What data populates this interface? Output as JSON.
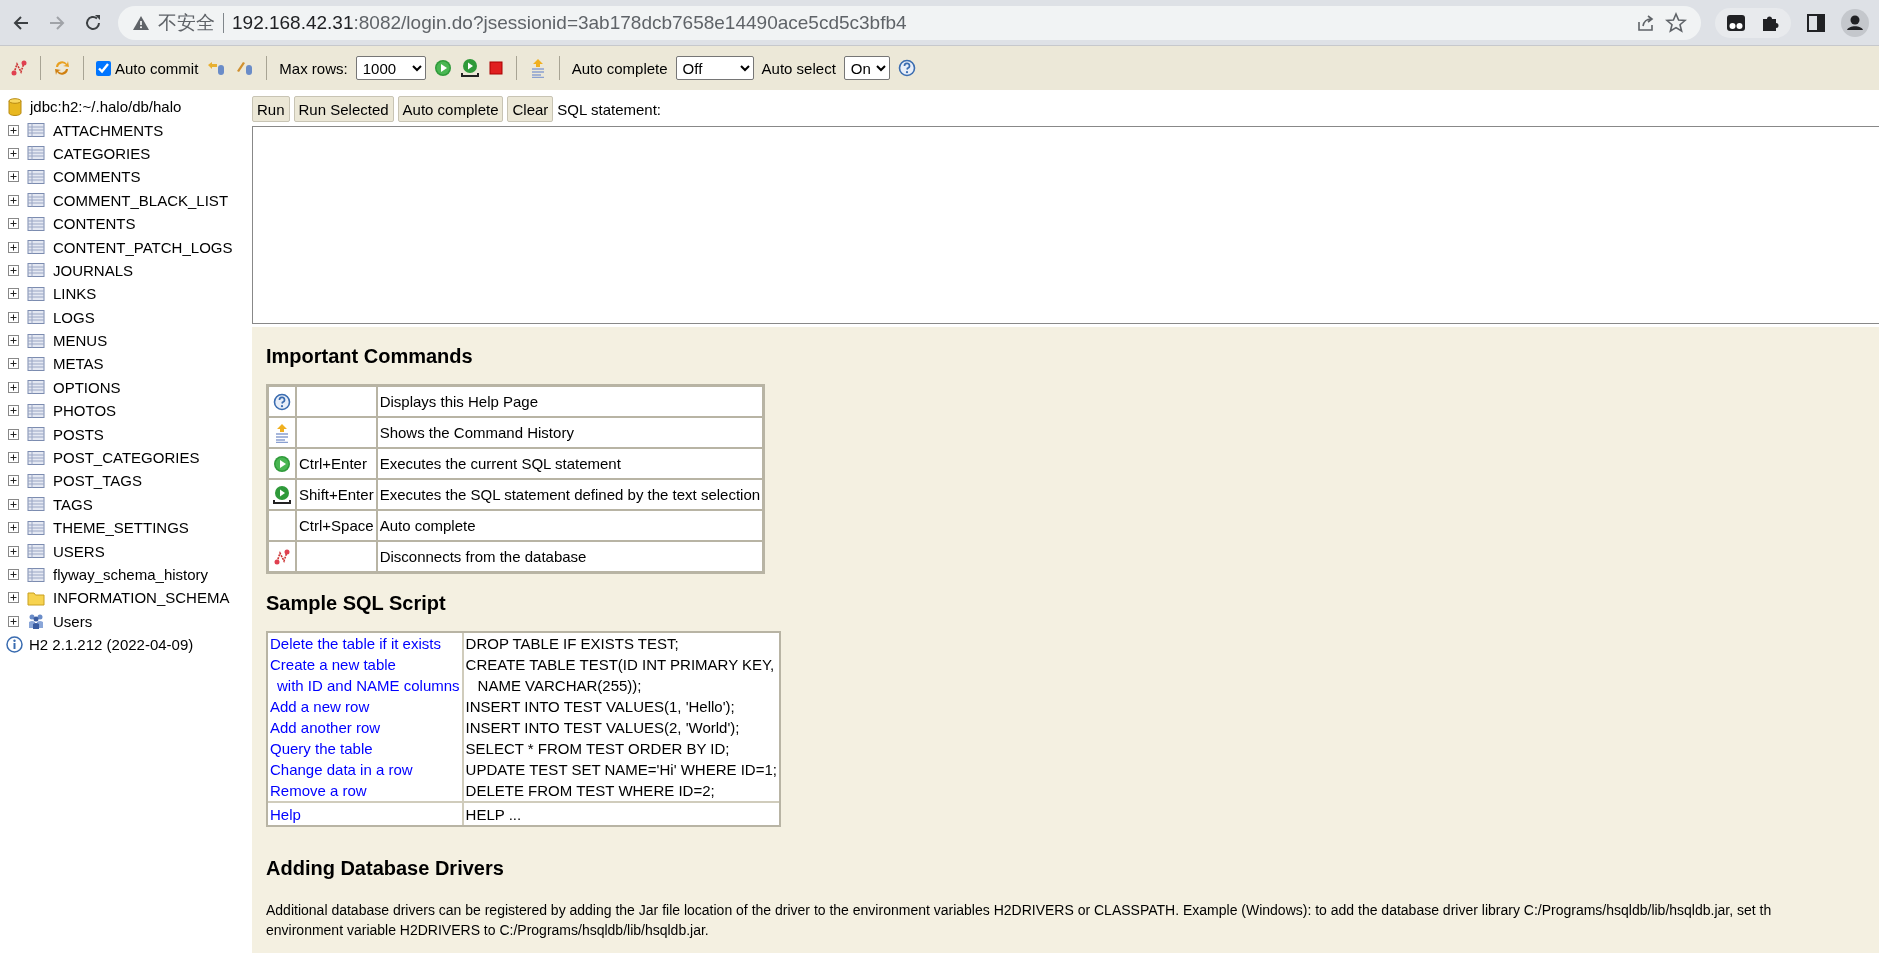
{
  "browser": {
    "security_label": "不安全",
    "url_host": "192.168.42.31",
    "url_rest": ":8082/login.do?jsessionid=3ab178dcb7658e14490ace5cd5c3bfb4"
  },
  "toolbar": {
    "auto_commit": {
      "label": "Auto commit",
      "checked": true
    },
    "max_rows": {
      "label": "Max rows:",
      "value": "1000"
    },
    "auto_complete": {
      "label": "Auto complete",
      "value": "Off"
    },
    "auto_select": {
      "label": "Auto select",
      "value": "On"
    }
  },
  "tree": {
    "connection": "jdbc:h2:~/.halo/db/halo",
    "items": [
      {
        "label": "ATTACHMENTS",
        "kind": "table",
        "expanded": false
      },
      {
        "label": "CATEGORIES",
        "kind": "table",
        "expanded": false
      },
      {
        "label": "COMMENTS",
        "kind": "table",
        "expanded": false
      },
      {
        "label": "COMMENT_BLACK_LIST",
        "kind": "table",
        "expanded": false
      },
      {
        "label": "CONTENTS",
        "kind": "table",
        "expanded": false
      },
      {
        "label": "CONTENT_PATCH_LOGS",
        "kind": "table",
        "expanded": false
      },
      {
        "label": "JOURNALS",
        "kind": "table",
        "expanded": false
      },
      {
        "label": "LINKS",
        "kind": "table",
        "expanded": false
      },
      {
        "label": "LOGS",
        "kind": "table",
        "expanded": false
      },
      {
        "label": "MENUS",
        "kind": "table",
        "expanded": false
      },
      {
        "label": "METAS",
        "kind": "table",
        "expanded": false
      },
      {
        "label": "OPTIONS",
        "kind": "table",
        "expanded": false
      },
      {
        "label": "PHOTOS",
        "kind": "table",
        "expanded": false
      },
      {
        "label": "POSTS",
        "kind": "table",
        "expanded": false
      },
      {
        "label": "POST_CATEGORIES",
        "kind": "table",
        "expanded": false
      },
      {
        "label": "POST_TAGS",
        "kind": "table",
        "expanded": false
      },
      {
        "label": "TAGS",
        "kind": "table",
        "expanded": false
      },
      {
        "label": "THEME_SETTINGS",
        "kind": "table",
        "expanded": false
      },
      {
        "label": "USERS",
        "kind": "table",
        "expanded": false
      },
      {
        "label": "flyway_schema_history",
        "kind": "table",
        "expanded": false
      },
      {
        "label": "INFORMATION_SCHEMA",
        "kind": "folder",
        "expanded": false
      },
      {
        "label": "Users",
        "kind": "users",
        "expanded": false
      }
    ],
    "version": "H2 2.1.212 (2022-04-09)"
  },
  "query": {
    "buttons": [
      "Run",
      "Run Selected",
      "Auto complete",
      "Clear"
    ],
    "label": "SQL statement:"
  },
  "help": {
    "commands_title": "Important Commands",
    "commands": [
      {
        "kind": "help",
        "text": "Displays this Help Page"
      },
      {
        "kind": "history",
        "text": "Shows the Command History"
      },
      {
        "kind": "run",
        "shortcut": "Ctrl+Enter",
        "text": "Executes the current SQL statement"
      },
      {
        "kind": "run_selected",
        "shortcut": "Shift+Enter",
        "text": "Executes the SQL statement defined by the text selection"
      },
      {
        "kind": "none",
        "shortcut": "Ctrl+Space",
        "text": "Auto complete"
      },
      {
        "kind": "disconnect",
        "text": "Disconnects from the database"
      }
    ],
    "sample_title": "Sample SQL Script",
    "samples": [
      {
        "label": "Delete the table if it exists",
        "sql": "DROP TABLE IF EXISTS TEST;",
        "continued": false
      },
      {
        "label": "Create a new table",
        "sql": "CREATE TABLE TEST(ID INT PRIMARY KEY,",
        "continued": false
      },
      {
        "label": "with ID and NAME columns",
        "sql": "NAME VARCHAR(255));",
        "continued": true
      },
      {
        "label": "Add a new row",
        "sql": "INSERT INTO TEST VALUES(1, 'Hello');",
        "continued": false
      },
      {
        "label": "Add another row",
        "sql": "INSERT INTO TEST VALUES(2, 'World');",
        "continued": false
      },
      {
        "label": "Query the table",
        "sql": "SELECT * FROM TEST ORDER BY ID;",
        "continued": false
      },
      {
        "label": "Change data in a row",
        "sql": "UPDATE TEST SET NAME='Hi' WHERE ID=1;",
        "continued": false
      },
      {
        "label": "Remove a row",
        "sql": "DELETE FROM TEST WHERE ID=2;",
        "continued": false
      }
    ],
    "help_row": {
      "label": "Help",
      "sql": "HELP ..."
    },
    "drivers_title": "Adding Database Drivers",
    "drivers_text": [
      "Additional database drivers can be registered by adding the Jar file location of the driver to the environment variables H2DRIVERS or CLASSPATH. Example (Windows): to add the database driver library C:/Programs/hsqldb/lib/hsqldb.jar, set th",
      "environment variable H2DRIVERS to C:/Programs/hsqldb/lib/hsqldb.jar."
    ]
  }
}
